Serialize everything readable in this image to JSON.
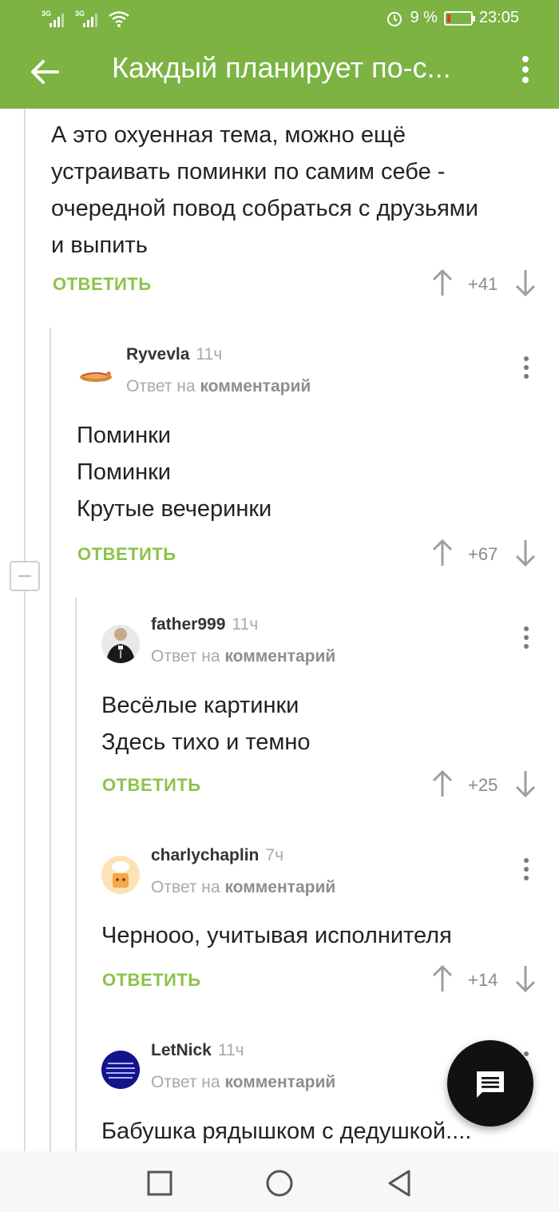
{
  "status_bar": {
    "network_1": "3G",
    "network_2": "3G",
    "battery_percent": "9 %",
    "time": "23:05",
    "battery_level": 0.09,
    "battery_color": "#e53935"
  },
  "app_bar": {
    "title": "Каждый планирует по-с...",
    "back_icon": "arrow-left-icon",
    "menu_icon": "more-vert-icon",
    "color": "#7cb342"
  },
  "comments": [
    {
      "text": "А это охуенная тема, можно ещё\nустраивать поминки по самим себе -\nочередной повод собраться с друзьями\nи выпить",
      "reply_label": "ОТВЕТИТЬ",
      "score": "+41"
    },
    {
      "username": "Ryvevla",
      "time": "11ч",
      "reply_prefix": "Ответ на",
      "reply_target": "комментарий",
      "text": "Поминки\nПоминки\nКрутые вечеринки",
      "reply_label": "ОТВЕТИТЬ",
      "score": "+67"
    },
    {
      "username": "father999",
      "time": "11ч",
      "reply_prefix": "Ответ на",
      "reply_target": "комментарий",
      "text": "Весёлые картинки\nЗдесь тихо и темно",
      "reply_label": "ОТВЕТИТЬ",
      "score": "+25"
    },
    {
      "username": "charlychaplin",
      "time": "7ч",
      "reply_prefix": "Ответ на",
      "reply_target": "комментарий",
      "text": "Черноoo, учитывая исполнителя",
      "reply_label": "ОТВЕТИТЬ",
      "score": "+14"
    },
    {
      "username": "LetNick",
      "time": "11ч",
      "reply_prefix": "Ответ на",
      "reply_target": "комментарий",
      "text": "Бабушка рядышком с дедушкой...."
    }
  ],
  "accent_color": "#8bc34a",
  "fab_icon": "comment-icon",
  "nav_icons": [
    "square-recents-icon",
    "circle-home-icon",
    "triangle-back-icon"
  ]
}
